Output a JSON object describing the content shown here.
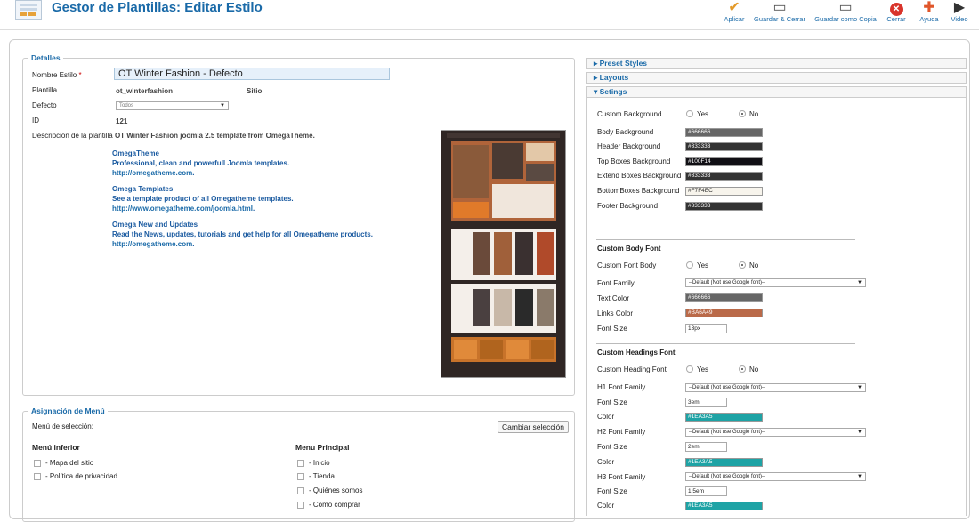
{
  "header": {
    "title": "Gestor de Plantillas: Editar Estilo",
    "buttons": [
      {
        "label": "Aplicar",
        "icon": "check-icon"
      },
      {
        "label": "Guardar & Cerrar",
        "icon": "save-icon"
      },
      {
        "label": "Guardar como Copia",
        "icon": "save-copy-icon"
      },
      {
        "label": "Cerrar",
        "icon": "close-icon"
      },
      {
        "label": "Ayuda",
        "icon": "help-icon"
      },
      {
        "label": "Video",
        "icon": "video-icon"
      }
    ]
  },
  "details": {
    "legend": "Detalles",
    "style_name_label": "Nombre Estilo",
    "required_mark": "*",
    "style_name_value": "OT Winter Fashion - Defecto",
    "template_label": "Plantilla",
    "template_value": "ot_winterfashion",
    "site_label": "Sitio",
    "default_label": "Defecto",
    "default_value": "Todos",
    "id_label": "ID",
    "id_value": "121",
    "description_label": "Descripción de la plantilla",
    "description_value": "OT Winter Fashion joomla 2.5 template from OmegaTheme.",
    "blocks": [
      {
        "title": "OmegaTheme",
        "text": "Professional, clean and powerfull Joomla templates.",
        "link": "http://omegatheme.com",
        "suffix": "."
      },
      {
        "title": "Omega Templates",
        "text": "See a template product of all Omegatheme templates.",
        "link": "http://www.omegatheme.com/joomla.html",
        "suffix": "."
      },
      {
        "title": "Omega New and Updates",
        "text": "Read the News, updates, tutorials and get help for all Omegatheme products.",
        "link": "http://omegatheme.com",
        "suffix": "."
      }
    ]
  },
  "menu_assignment": {
    "legend": "Asignación de Menú",
    "selection_label": "Menú de selección:",
    "change_button": "Cambiar selección",
    "col1_title": "Menú inferior",
    "col1_items": [
      "- Mapa del sitio",
      "- Política de privacidad"
    ],
    "col2_title": "Menu Principal",
    "col2_items": [
      "- Inicio",
      "- Tienda",
      "- Quiénes somos",
      "- Cómo comprar"
    ]
  },
  "accordion": {
    "preset": "Preset Styles",
    "layouts": "Layouts",
    "settings": "Setings"
  },
  "settings": {
    "yes": "Yes",
    "no": "No",
    "custom_background_label": "Custom Background",
    "backgrounds": [
      {
        "label": "Body Background",
        "value": "#666666",
        "color": "#666666"
      },
      {
        "label": "Header Background",
        "value": "#333333",
        "color": "#333333"
      },
      {
        "label": "Top Boxes Background",
        "value": "#100F14",
        "color": "#100F14"
      },
      {
        "label": "Extend Boxes Background",
        "value": "#333333",
        "color": "#333333"
      },
      {
        "label": "BottomBoxes Background",
        "value": "#F7F4EC",
        "color": "#F7F4EC"
      },
      {
        "label": "Footer Background",
        "value": "#333333",
        "color": "#333333"
      }
    ],
    "body_font_title": "Custom Body Font",
    "custom_font_body_label": "Custom Font Body",
    "font_family_label": "Font Family",
    "font_family_value": "--Default (Not use Google font)--",
    "text_color_label": "Text Color",
    "text_color_value": "#666666",
    "links_color_label": "Links Color",
    "links_color_value": "#BA6A49",
    "font_size_label": "Font Size",
    "body_font_size": "13px",
    "headings_title": "Custom Headings Font",
    "custom_heading_font_label": "Custom Heading Font",
    "h1_label": "H1 Font Family",
    "h1_size": "3em",
    "h2_label": "H2 Font Family",
    "h2_size": "2em",
    "h3_label": "H3 Font Family",
    "h3_size": "1.5em",
    "color_label": "Color",
    "heading_color": "#1EA3A5"
  }
}
